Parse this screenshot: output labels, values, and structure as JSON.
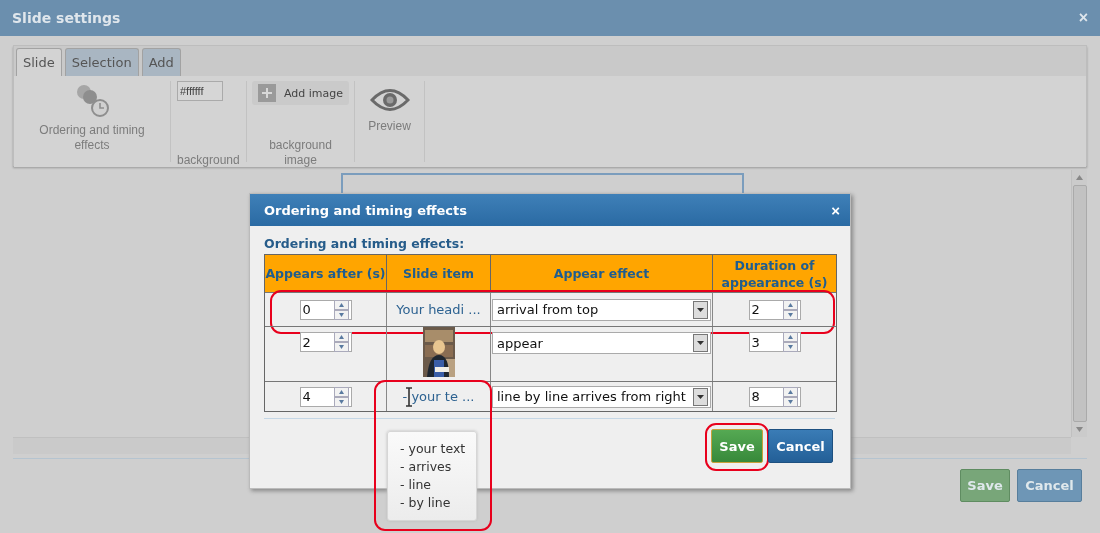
{
  "window": {
    "title": "Slide settings",
    "close": "×"
  },
  "tabs": [
    {
      "label": "Slide",
      "selected": true
    },
    {
      "label": "Selection",
      "selected": false
    },
    {
      "label": "Add",
      "selected": false
    }
  ],
  "ribbon": [
    {
      "kind": "ordering",
      "label": "Ordering and timing effects"
    },
    {
      "kind": "color",
      "value": "#ffffff",
      "label": "background"
    },
    {
      "button": "Add image",
      "label": "background image"
    },
    {
      "kind": "preview",
      "label": "Preview"
    }
  ],
  "footer_buttons": [
    {
      "kind": "save",
      "label": "Save"
    },
    {
      "kind": "cancel",
      "label": "Cancel"
    }
  ],
  "dialog": {
    "title": "Ordering and timing effects",
    "close": "×",
    "heading": "Ordering and timing effects:",
    "columns": [
      "Appears after (s)",
      "Slide item",
      "Appear effect",
      "Duration of appearance (s)"
    ],
    "rows": [
      {
        "appears_after": "0",
        "item": {
          "kind": "text",
          "text": "Your headi ..."
        },
        "effect": "arrival from top",
        "duration": "2",
        "highlighted": true
      },
      {
        "appears_after": "2",
        "effect": "appear",
        "duration": "3",
        "highlighted": false
      },
      {
        "appears_after": "4",
        "item": {
          "kind": "text",
          "text": "- your te ...",
          "hovered": true
        },
        "effect": "line by line arrives from right",
        "duration": "8",
        "highlighted": false
      }
    ],
    "tooltip": {
      "lines": [
        "- your text",
        "- arrives",
        "- line",
        "- by line"
      ],
      "highlighted": true
    },
    "buttons": [
      {
        "kind": "save",
        "label": "Save",
        "highlighted": true
      },
      {
        "kind": "cancel",
        "label": "Cancel",
        "highlighted": false
      }
    ]
  }
}
